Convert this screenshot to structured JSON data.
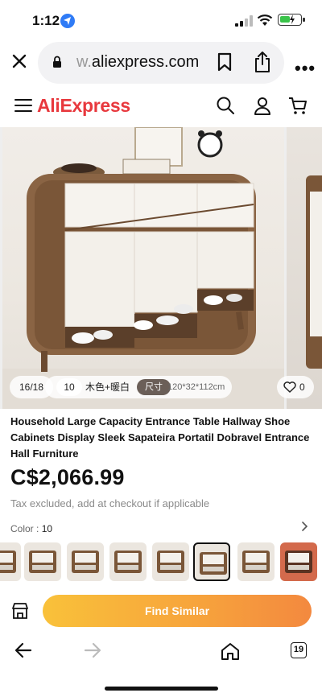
{
  "status": {
    "time": "1:12"
  },
  "browser": {
    "url_prefix": "w.",
    "url_main": "aliexpress.com",
    "tab_count": "19"
  },
  "app": {
    "logo": "AliExpress"
  },
  "gallery": {
    "page_indicator": "16/18",
    "sku_number": "10",
    "sku_color_text": "木色+暖白",
    "size_tag": "尺寸",
    "size_value": "120*32*112cm",
    "likes": "0"
  },
  "product": {
    "title": "Household Large Capacity Entrance Table Hallway Shoe Cabinets Display Sleek Sapateira Portatil Dobravel Entrance Hall Furniture",
    "price": "C$2,066.99",
    "tax_note": "Tax excluded, add at checkout if applicable",
    "color_label": "Color : ",
    "color_value": "10",
    "thumbnail_count": 8,
    "selected_thumbnail": 6
  },
  "actions": {
    "find_similar": "Find Similar"
  },
  "icons": [
    "close-icon",
    "lock-icon",
    "bookmark-icon",
    "share-icon",
    "more-icon",
    "menu-icon",
    "search-icon",
    "account-icon",
    "cart-icon",
    "heart-icon",
    "chevron-right-icon",
    "store-icon",
    "back-icon",
    "forward-icon",
    "home-icon",
    "tabs-icon"
  ],
  "colors": {
    "brand": "#e8383d",
    "button_start": "#f9c13a",
    "button_end": "#f3893f"
  }
}
